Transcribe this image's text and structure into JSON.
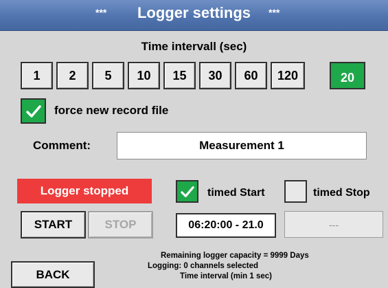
{
  "window": {
    "title": "Logger settings",
    "stars": "***"
  },
  "interval": {
    "label": "Time intervall (sec)",
    "options": [
      "1",
      "2",
      "5",
      "10",
      "15",
      "30",
      "60",
      "120",
      "20"
    ],
    "selected_index": 8
  },
  "force_new": {
    "checked": true,
    "label": "force new record file"
  },
  "comment": {
    "label": "Comment:",
    "value": "Measurement 1"
  },
  "logger": {
    "status": "Logger stopped",
    "status_color": "#ee3b3b"
  },
  "controls": {
    "start": "START",
    "stop": "STOP",
    "back": "BACK"
  },
  "timed_start": {
    "checked": true,
    "label": "timed Start",
    "value": "06:20:00 - 21.0"
  },
  "timed_stop": {
    "checked": false,
    "label": "timed Stop",
    "value": "---"
  },
  "info": {
    "capacity_label": "Remaining logger capacity",
    "capacity_eq": "=",
    "capacity_value": "9999",
    "capacity_unit": "Days",
    "channels": "Logging: 0 channels selected",
    "interval_note": "Time interval (min 1 sec)"
  },
  "colors": {
    "accent": "#1fa84a",
    "titlebar": "#4f72ad",
    "alert": "#ee3b3b"
  },
  "icons": {
    "check": "checkmark-icon"
  }
}
